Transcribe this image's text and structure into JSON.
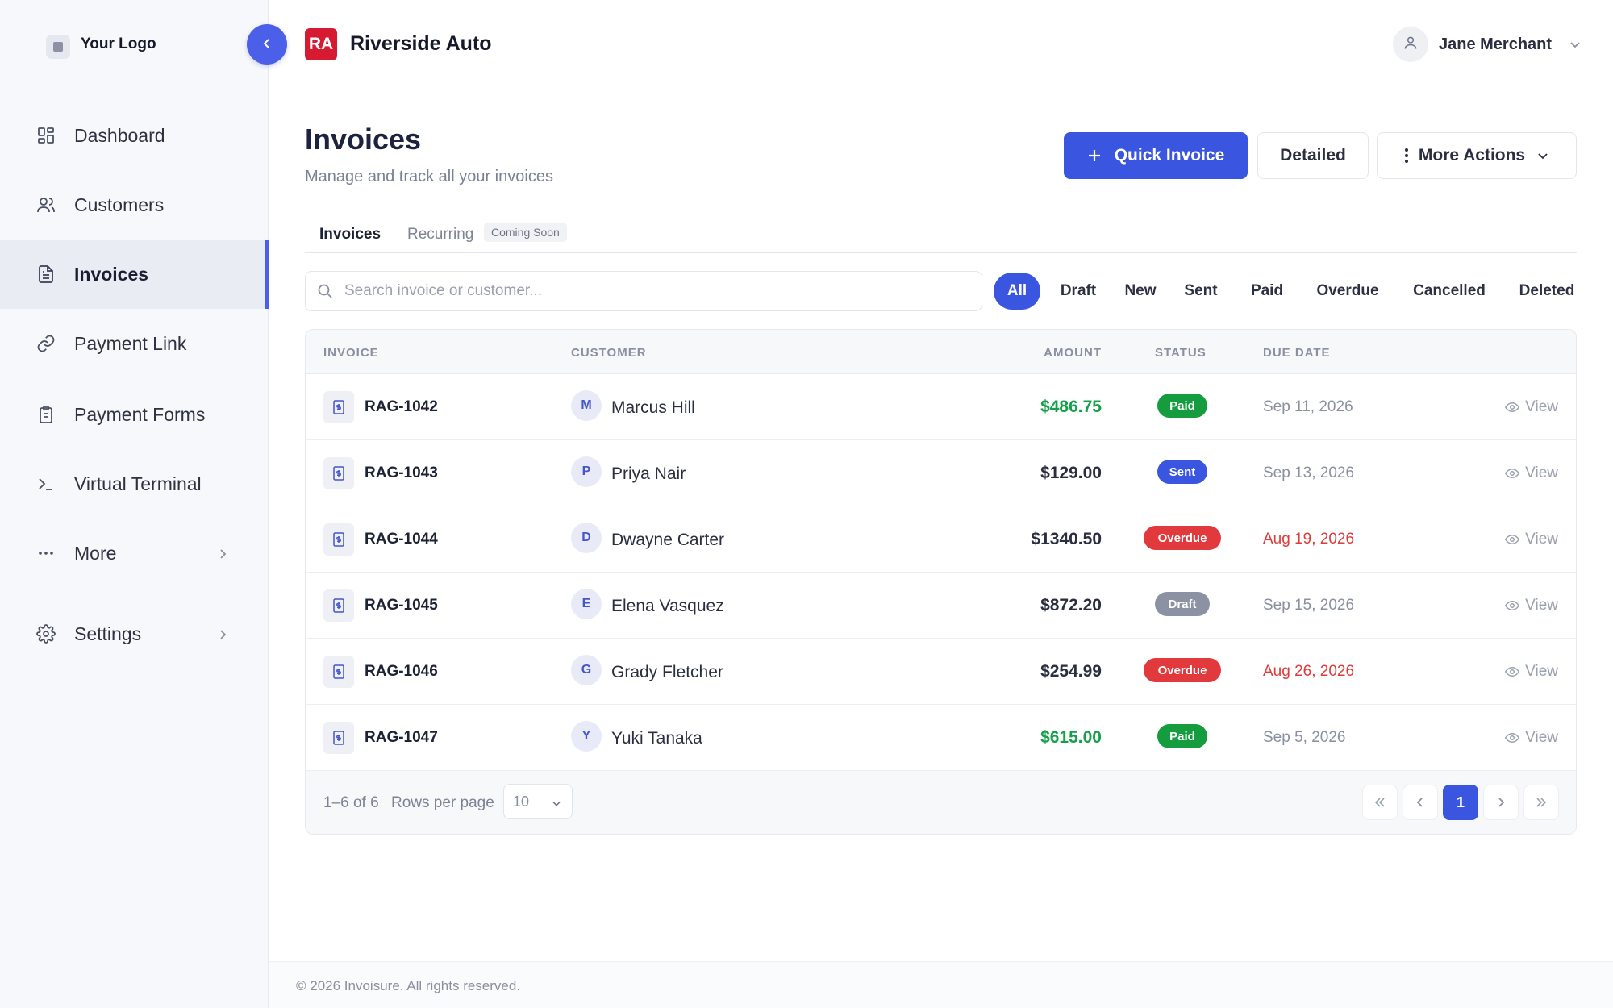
{
  "sidebar": {
    "logo_text": "Your Logo",
    "items": [
      {
        "label": "Dashboard",
        "icon": "dashboard-icon"
      },
      {
        "label": "Customers",
        "icon": "users-icon"
      },
      {
        "label": "Invoices",
        "icon": "document-icon",
        "active": true
      },
      {
        "label": "Payment Link",
        "icon": "link-icon"
      },
      {
        "label": "Payment Forms",
        "icon": "clipboard-icon"
      },
      {
        "label": "Virtual Terminal",
        "icon": "terminal-icon"
      },
      {
        "label": "More",
        "icon": "more-icon"
      }
    ],
    "settings_label": "Settings"
  },
  "header": {
    "badge": "RA",
    "brand": "Riverside Auto",
    "user_name": "Jane Merchant"
  },
  "page": {
    "title": "Invoices",
    "subtitle": "Manage and track all your invoices",
    "actions": {
      "quick_invoice": "Quick Invoice",
      "detailed": "Detailed",
      "more_actions": "More Actions"
    },
    "tabs": {
      "invoices": "Invoices",
      "recurring": "Recurring",
      "coming_soon": "Coming Soon"
    },
    "search_placeholder": "Search invoice or customer...",
    "filters": [
      "All",
      "Draft",
      "New",
      "Sent",
      "Paid",
      "Overdue",
      "Cancelled",
      "Deleted"
    ],
    "active_filter": "All"
  },
  "table": {
    "headers": {
      "invoice": "INVOICE",
      "customer": "CUSTOMER",
      "amount": "AMOUNT",
      "status": "STATUS",
      "due_date": "DUE DATE"
    },
    "rows": [
      {
        "invoice": "RAG-1042",
        "initial": "M",
        "customer": "Marcus Hill",
        "amount": "$486.75",
        "status": "Paid",
        "due": "Sep 11, 2026",
        "view": "View"
      },
      {
        "invoice": "RAG-1043",
        "initial": "P",
        "customer": "Priya Nair",
        "amount": "$129.00",
        "status": "Sent",
        "due": "Sep 13, 2026",
        "view": "View"
      },
      {
        "invoice": "RAG-1044",
        "initial": "D",
        "customer": "Dwayne Carter",
        "amount": "$1340.50",
        "status": "Overdue",
        "due": "Aug 19, 2026",
        "view": "View"
      },
      {
        "invoice": "RAG-1045",
        "initial": "E",
        "customer": "Elena Vasquez",
        "amount": "$872.20",
        "status": "Draft",
        "due": "Sep 15, 2026",
        "view": "View"
      },
      {
        "invoice": "RAG-1046",
        "initial": "G",
        "customer": "Grady Fletcher",
        "amount": "$254.99",
        "status": "Overdue",
        "due": "Aug 26, 2026",
        "view": "View"
      },
      {
        "invoice": "RAG-1047",
        "initial": "Y",
        "customer": "Yuki Tanaka",
        "amount": "$615.00",
        "status": "Paid",
        "due": "Sep 5, 2026",
        "view": "View"
      }
    ],
    "footer": {
      "range": "1–6 of 6",
      "rows_per_page_label": "Rows per page",
      "rows_per_page": "10",
      "current_page": "1"
    }
  },
  "footer": {
    "copyright": "© 2026 Invoisure. All rights reserved."
  },
  "colors": {
    "accent": "#3a55e0",
    "brand_badge": "#d51a32",
    "paid": "#149c3e",
    "overdue": "#e2393d",
    "draft": "#8c92a4"
  }
}
